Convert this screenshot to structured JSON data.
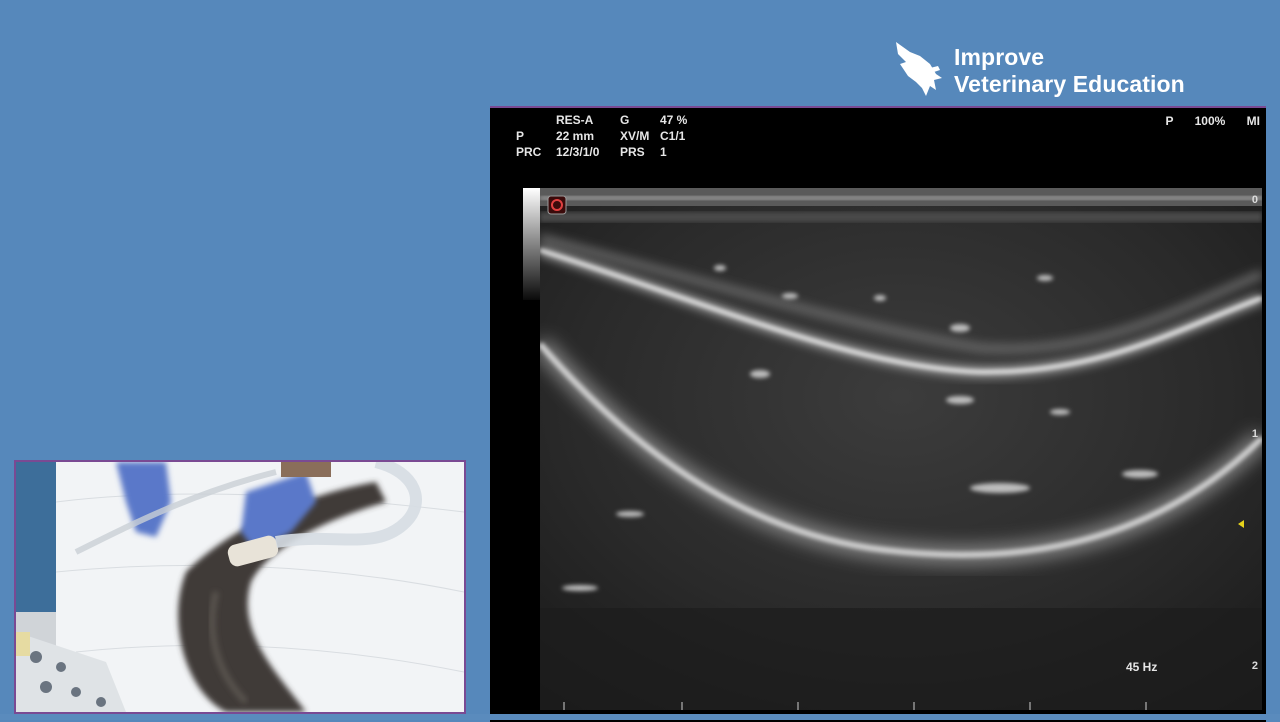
{
  "brand": {
    "line1": "Improve",
    "line2": "Veterinary Education",
    "logo_icon": "eagle-icon"
  },
  "ultrasound": {
    "header": {
      "row1": {
        "preset": "RES-A",
        "gain_label": "G",
        "gain_value": "47 %"
      },
      "row2": {
        "label": "P",
        "depth": "22 mm",
        "mode": "XV/M",
        "map": "C1/1"
      },
      "row3": {
        "label": "PRC",
        "prc_value": "12/3/1/0",
        "prs_label": "PRS",
        "prs_value": "1"
      }
    },
    "power": {
      "label": "P",
      "value": "100%",
      "mi": "MI"
    },
    "depth_marks": [
      "0",
      "1",
      "2"
    ],
    "frame_rate": "45 Hz",
    "colors": {
      "background": "#000000",
      "text": "#e6e6e6",
      "focus_marker": "#e6d21a"
    }
  },
  "video": {
    "description_icon": "procedure-video-icon"
  },
  "colors": {
    "page_background": "#5688bb",
    "panel_border": "#7a4a93"
  }
}
